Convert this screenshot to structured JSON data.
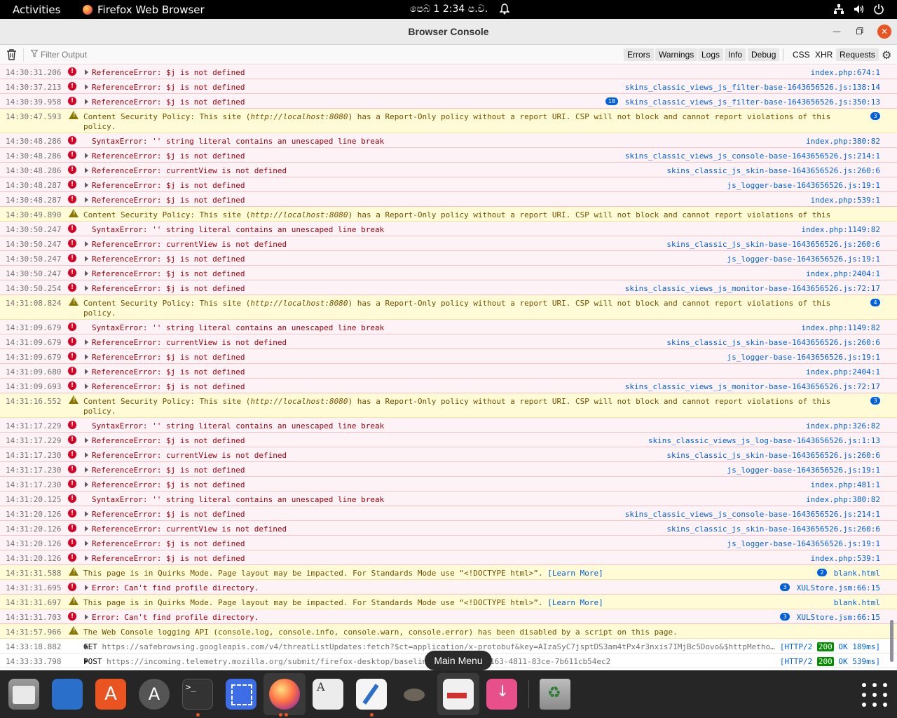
{
  "topbar": {
    "activities": "Activities",
    "app_name": "Firefox Web Browser",
    "clock": "පෙබ 1  2:34 ප.ව."
  },
  "window": {
    "title": "Browser Console"
  },
  "toolbar": {
    "filter_placeholder": "Filter Output",
    "errors": "Errors",
    "warnings": "Warnings",
    "logs": "Logs",
    "info": "Info",
    "debug": "Debug",
    "css": "CSS",
    "xhr": "XHR",
    "requests": "Requests"
  },
  "rows": [
    {
      "kind": "error",
      "ts": "14:30:31.206",
      "arrow": true,
      "msg": "ReferenceError: $j is not defined",
      "src": "index.php:674:1"
    },
    {
      "kind": "error",
      "ts": "14:30:37.213",
      "arrow": true,
      "msg": "ReferenceError: $j is not defined",
      "src": "skins_classic_views_js_filter-base-1643656526.js:138:14"
    },
    {
      "kind": "error",
      "ts": "14:30:39.958",
      "arrow": true,
      "msg": "ReferenceError: $j is not defined",
      "src": "skins_classic_views_js_filter-base-1643656526.js:350:13",
      "badge": "18"
    },
    {
      "kind": "warn",
      "ts": "14:30:47.593",
      "tall": true,
      "msg_pre": "Content Security Policy: This site (",
      "msg_it": "http://localhost:8080",
      "msg_post": ") has a Report-Only policy without a report URI. CSP will not block and cannot report violations of this policy.",
      "badge": "3"
    },
    {
      "kind": "error",
      "ts": "14:30:48.286",
      "arrow": false,
      "msg": "SyntaxError: '' string literal contains an unescaped line break",
      "src": "index.php:380:82"
    },
    {
      "kind": "error",
      "ts": "14:30:48.286",
      "arrow": true,
      "msg": "ReferenceError: $j is not defined",
      "src": "skins_classic_views_js_console-base-1643656526.js:214:1"
    },
    {
      "kind": "error",
      "ts": "14:30:48.286",
      "arrow": true,
      "msg": "ReferenceError: currentView is not defined",
      "src": "skins_classic_js_skin-base-1643656526.js:260:6"
    },
    {
      "kind": "error",
      "ts": "14:30:48.287",
      "arrow": true,
      "msg": "ReferenceError: $j is not defined",
      "src": "js_logger-base-1643656526.js:19:1"
    },
    {
      "kind": "error",
      "ts": "14:30:48.287",
      "arrow": true,
      "msg": "ReferenceError: $j is not defined",
      "src": "index.php:539:1"
    },
    {
      "kind": "warn",
      "ts": "14:30:49.890",
      "tall": false,
      "msg_pre": "Content Security Policy: This site (",
      "msg_it": "http://localhost:8080",
      "msg_post": ") has a Report-Only policy without a report URI. CSP will not block and cannot report violations of this policy."
    },
    {
      "kind": "error",
      "ts": "14:30:50.247",
      "arrow": false,
      "msg": "SyntaxError: '' string literal contains an unescaped line break",
      "src": "index.php:1149:82"
    },
    {
      "kind": "error",
      "ts": "14:30:50.247",
      "arrow": true,
      "msg": "ReferenceError: currentView is not defined",
      "src": "skins_classic_js_skin-base-1643656526.js:260:6"
    },
    {
      "kind": "error",
      "ts": "14:30:50.247",
      "arrow": true,
      "msg": "ReferenceError: $j is not defined",
      "src": "js_logger-base-1643656526.js:19:1"
    },
    {
      "kind": "error",
      "ts": "14:30:50.247",
      "arrow": true,
      "msg": "ReferenceError: $j is not defined",
      "src": "index.php:2404:1"
    },
    {
      "kind": "error",
      "ts": "14:30:50.254",
      "arrow": true,
      "msg": "ReferenceError: $j is not defined",
      "src": "skins_classic_views_js_monitor-base-1643656526.js:72:17"
    },
    {
      "kind": "warn",
      "ts": "14:31:08.824",
      "tall": true,
      "msg_pre": "Content Security Policy: This site (",
      "msg_it": "http://localhost:8080",
      "msg_post": ") has a Report-Only policy without a report URI. CSP will not block and cannot report violations of this policy.",
      "badge": "4"
    },
    {
      "kind": "error",
      "ts": "14:31:09.679",
      "arrow": false,
      "msg": "SyntaxError: '' string literal contains an unescaped line break",
      "src": "index.php:1149:82"
    },
    {
      "kind": "error",
      "ts": "14:31:09.679",
      "arrow": true,
      "msg": "ReferenceError: currentView is not defined",
      "src": "skins_classic_js_skin-base-1643656526.js:260:6"
    },
    {
      "kind": "error",
      "ts": "14:31:09.679",
      "arrow": true,
      "msg": "ReferenceError: $j is not defined",
      "src": "js_logger-base-1643656526.js:19:1"
    },
    {
      "kind": "error",
      "ts": "14:31:09.680",
      "arrow": true,
      "msg": "ReferenceError: $j is not defined",
      "src": "index.php:2404:1"
    },
    {
      "kind": "error",
      "ts": "14:31:09.693",
      "arrow": true,
      "msg": "ReferenceError: $j is not defined",
      "src": "skins_classic_views_js_monitor-base-1643656526.js:72:17"
    },
    {
      "kind": "warn",
      "ts": "14:31:16.552",
      "tall": true,
      "msg_pre": "Content Security Policy: This site (",
      "msg_it": "http://localhost:8080",
      "msg_post": ") has a Report-Only policy without a report URI. CSP will not block and cannot report violations of this policy.",
      "badge": "3"
    },
    {
      "kind": "error",
      "ts": "14:31:17.229",
      "arrow": false,
      "msg": "SyntaxError: '' string literal contains an unescaped line break",
      "src": "index.php:326:82"
    },
    {
      "kind": "error",
      "ts": "14:31:17.229",
      "arrow": true,
      "msg": "ReferenceError: $j is not defined",
      "src": "skins_classic_views_js_log-base-1643656526.js:1:13"
    },
    {
      "kind": "error",
      "ts": "14:31:17.230",
      "arrow": true,
      "msg": "ReferenceError: currentView is not defined",
      "src": "skins_classic_js_skin-base-1643656526.js:260:6"
    },
    {
      "kind": "error",
      "ts": "14:31:17.230",
      "arrow": true,
      "msg": "ReferenceError: $j is not defined",
      "src": "js_logger-base-1643656526.js:19:1"
    },
    {
      "kind": "error",
      "ts": "14:31:17.230",
      "arrow": true,
      "msg": "ReferenceError: $j is not defined",
      "src": "index.php:481:1"
    },
    {
      "kind": "error",
      "ts": "14:31:20.125",
      "arrow": false,
      "msg": "SyntaxError: '' string literal contains an unescaped line break",
      "src": "index.php:380:82"
    },
    {
      "kind": "error",
      "ts": "14:31:20.126",
      "arrow": true,
      "msg": "ReferenceError: $j is not defined",
      "src": "skins_classic_views_js_console-base-1643656526.js:214:1"
    },
    {
      "kind": "error",
      "ts": "14:31:20.126",
      "arrow": true,
      "msg": "ReferenceError: currentView is not defined",
      "src": "skins_classic_js_skin-base-1643656526.js:260:6"
    },
    {
      "kind": "error",
      "ts": "14:31:20.126",
      "arrow": true,
      "msg": "ReferenceError: $j is not defined",
      "src": "js_logger-base-1643656526.js:19:1"
    },
    {
      "kind": "error",
      "ts": "14:31:20.126",
      "arrow": true,
      "msg": "ReferenceError: $j is not defined",
      "src": "index.php:539:1"
    },
    {
      "kind": "warn",
      "ts": "14:31:31.588",
      "tall": false,
      "msg_pre": "This page is in Quirks Mode. Page layout may be impacted. For Standards Mode use “<!DOCTYPE html>”. ",
      "link": "[Learn More]",
      "src": "blank.html",
      "badge": "2"
    },
    {
      "kind": "error",
      "ts": "14:31:31.695",
      "arrow": true,
      "msg": "Error: Can't find profile directory.",
      "src": "XULStore.jsm:66:15",
      "badge": "3"
    },
    {
      "kind": "warn",
      "ts": "14:31:31.697",
      "tall": false,
      "msg_pre": "This page is in Quirks Mode. Page layout may be impacted. For Standards Mode use “<!DOCTYPE html>”. ",
      "link": "[Learn More]",
      "src": "blank.html"
    },
    {
      "kind": "error",
      "ts": "14:31:31.703",
      "arrow": true,
      "msg": "Error: Can't find profile directory.",
      "src": "XULStore.jsm:66:15",
      "badge": "3"
    },
    {
      "kind": "warn",
      "ts": "14:31:57.966",
      "tall": false,
      "msg_pre": "The Web Console logging API (console.log, console.info, console.warn, console.error) has been disabled by a script on this page."
    },
    {
      "kind": "net",
      "ts": "14:33:18.882",
      "verb": "GET",
      "url": "https://safebrowsing.googleapis.com/v4/threatListUpdates:fetch?$ct=application/x-protobuf&key=AIzaSyC7jsptDS3am4tPx4r3nxis7IMjBc5Dovo&$httpMetho…",
      "proto": "[HTTP/2 ",
      "code": "200",
      "tail": " OK 189ms]"
    },
    {
      "kind": "net",
      "ts": "14:33:33.798",
      "verb": "POST",
      "url": "https://incoming.telemetry.mozilla.org/submit/firefox-desktop/baselin",
      "url_tail": "163-4811-83ce-7b611cb54ec2",
      "proto": "[HTTP/2 ",
      "code": "200",
      "tail": " OK 539ms]"
    }
  ],
  "tooltip": "Main Menu",
  "dock": {
    "terminal_glyph": ">_"
  }
}
